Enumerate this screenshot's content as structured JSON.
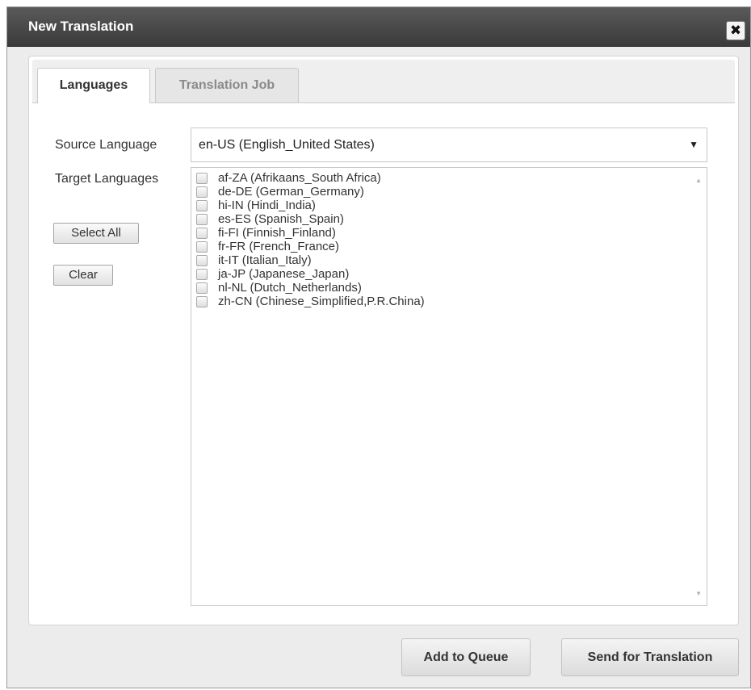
{
  "dialog": {
    "title": "New Translation",
    "close_symbol": "✖"
  },
  "tabs": [
    {
      "label": "Languages",
      "active": true
    },
    {
      "label": "Translation Job",
      "active": false
    }
  ],
  "source": {
    "label": "Source Language",
    "selected": "en-US  (English_United States)",
    "arrow": "▼"
  },
  "target": {
    "label": "Target Languages",
    "select_all_label": "Select All",
    "clear_label": "Clear",
    "items": [
      {
        "label": "af-ZA  (Afrikaans_South Africa)",
        "checked": false
      },
      {
        "label": "de-DE  (German_Germany)",
        "checked": false
      },
      {
        "label": "hi-IN  (Hindi_India)",
        "checked": false
      },
      {
        "label": "es-ES  (Spanish_Spain)",
        "checked": false
      },
      {
        "label": "fi-FI  (Finnish_Finland)",
        "checked": false
      },
      {
        "label": "fr-FR  (French_France)",
        "checked": false
      },
      {
        "label": "it-IT  (Italian_Italy)",
        "checked": false
      },
      {
        "label": "ja-JP  (Japanese_Japan)",
        "checked": false
      },
      {
        "label": "nl-NL  (Dutch_Netherlands)",
        "checked": false
      },
      {
        "label": "zh-CN  (Chinese_Simplified,P.R.China)",
        "checked": false
      }
    ],
    "scroll_up_symbol": "▲",
    "scroll_down_symbol": "▼"
  },
  "footer": {
    "add_to_queue_label": "Add to Queue",
    "send_label": "Send for Translation"
  }
}
